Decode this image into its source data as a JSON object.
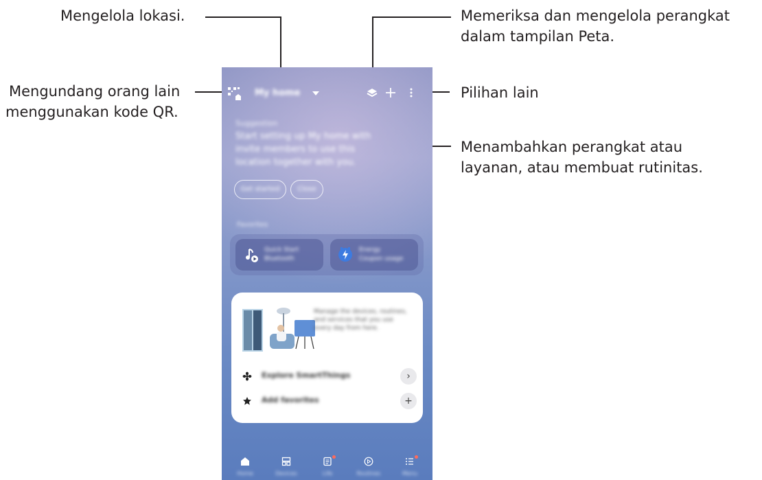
{
  "callouts": {
    "manage_location": "Mengelola lokasi.",
    "invite_line1": "Mengundang orang lain",
    "invite_line2": "menggunakan kode QR.",
    "map_line1": "Memeriksa dan mengelola perangkat",
    "map_line2": "dalam tampilan Peta.",
    "more_options": "Pilihan lain",
    "add_line1": "Menambahkan perangkat atau",
    "add_line2": "layanan, atau membuat rutinitas."
  },
  "phone": {
    "location_name": "My home",
    "welcome": {
      "small": "Suggestion",
      "line1": "Start setting up My home with",
      "line2": "invite members to use this",
      "line3": "location together with you."
    },
    "chips": [
      "Get started",
      "Close"
    ],
    "favorites_label": "Favorites",
    "favorites": [
      {
        "line1": "Quick Start",
        "line2": "Bluetooth",
        "icon": "music-note-play-icon"
      },
      {
        "line1": "Energy",
        "line2": "Coupon usage",
        "icon": "energy-bolt-icon"
      }
    ],
    "promo": {
      "description": "Manage the devices, routines, and services that you use every day from here.",
      "rows": [
        {
          "label": "Explore SmartThings",
          "icon": "fan-icon",
          "action_icon": "chevron-right-icon"
        },
        {
          "label": "Add favorites",
          "icon": "star-icon",
          "action_icon": "plus-icon"
        }
      ]
    },
    "nav": [
      {
        "label": "Home",
        "icon": "home-icon",
        "badge": false
      },
      {
        "label": "Devices",
        "icon": "devices-icon",
        "badge": false
      },
      {
        "label": "Life",
        "icon": "life-icon",
        "badge": true
      },
      {
        "label": "Routines",
        "icon": "routines-icon",
        "badge": false
      },
      {
        "label": "Menu",
        "icon": "menu-icon",
        "badge": true
      }
    ]
  },
  "colors": {
    "accent": "#3d7be0",
    "badge": "#ff6b5a",
    "text": "#231f20"
  }
}
